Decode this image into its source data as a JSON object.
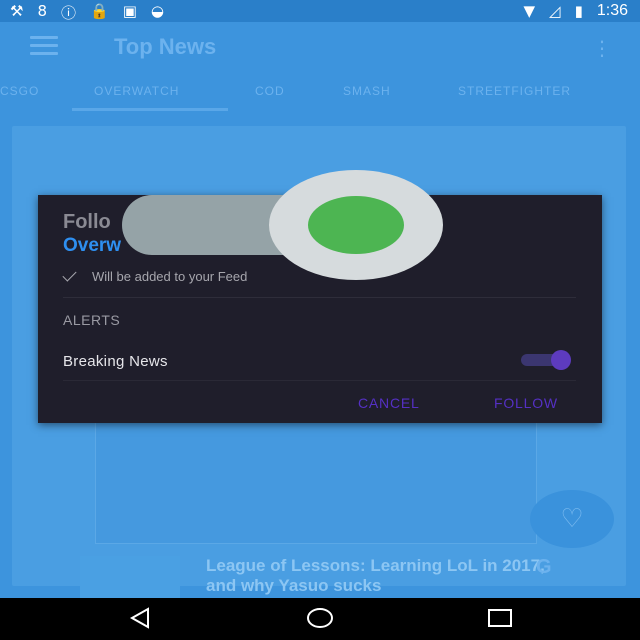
{
  "status_bar": {
    "icons": [
      "tools-icon",
      "app-8-icon",
      "info-icon",
      "lock-icon",
      "briefcase-icon",
      "android-icon"
    ],
    "right_icons": [
      "wifi-icon",
      "no-signal-icon",
      "battery-charging-icon"
    ],
    "time": "1:36"
  },
  "app_bar": {
    "title": "Top News"
  },
  "tabs": [
    {
      "label": "CSGO"
    },
    {
      "label": "OVERWATCH"
    },
    {
      "label": "COD"
    },
    {
      "label": "SMASH"
    },
    {
      "label": "STREETFIGHTER"
    }
  ],
  "background_article": {
    "title": "League of Lessons: Learning LoL in 2017, and why Yasuo sucks",
    "badge": "G"
  },
  "dialog": {
    "title": "Follo",
    "subtitle": "Overw",
    "feed_note": "Will be added to your Feed",
    "alerts_label": "ALERTS",
    "breaking_news_label": "Breaking News",
    "breaking_news_enabled": true,
    "cancel_label": "CANCEL",
    "follow_label": "FOLLOW"
  },
  "colors": {
    "accent_blue": "#2e8ff0",
    "dialog_bg": "#1f1e2b",
    "button_purple": "#5530c4",
    "toggle_green": "#4db552"
  }
}
